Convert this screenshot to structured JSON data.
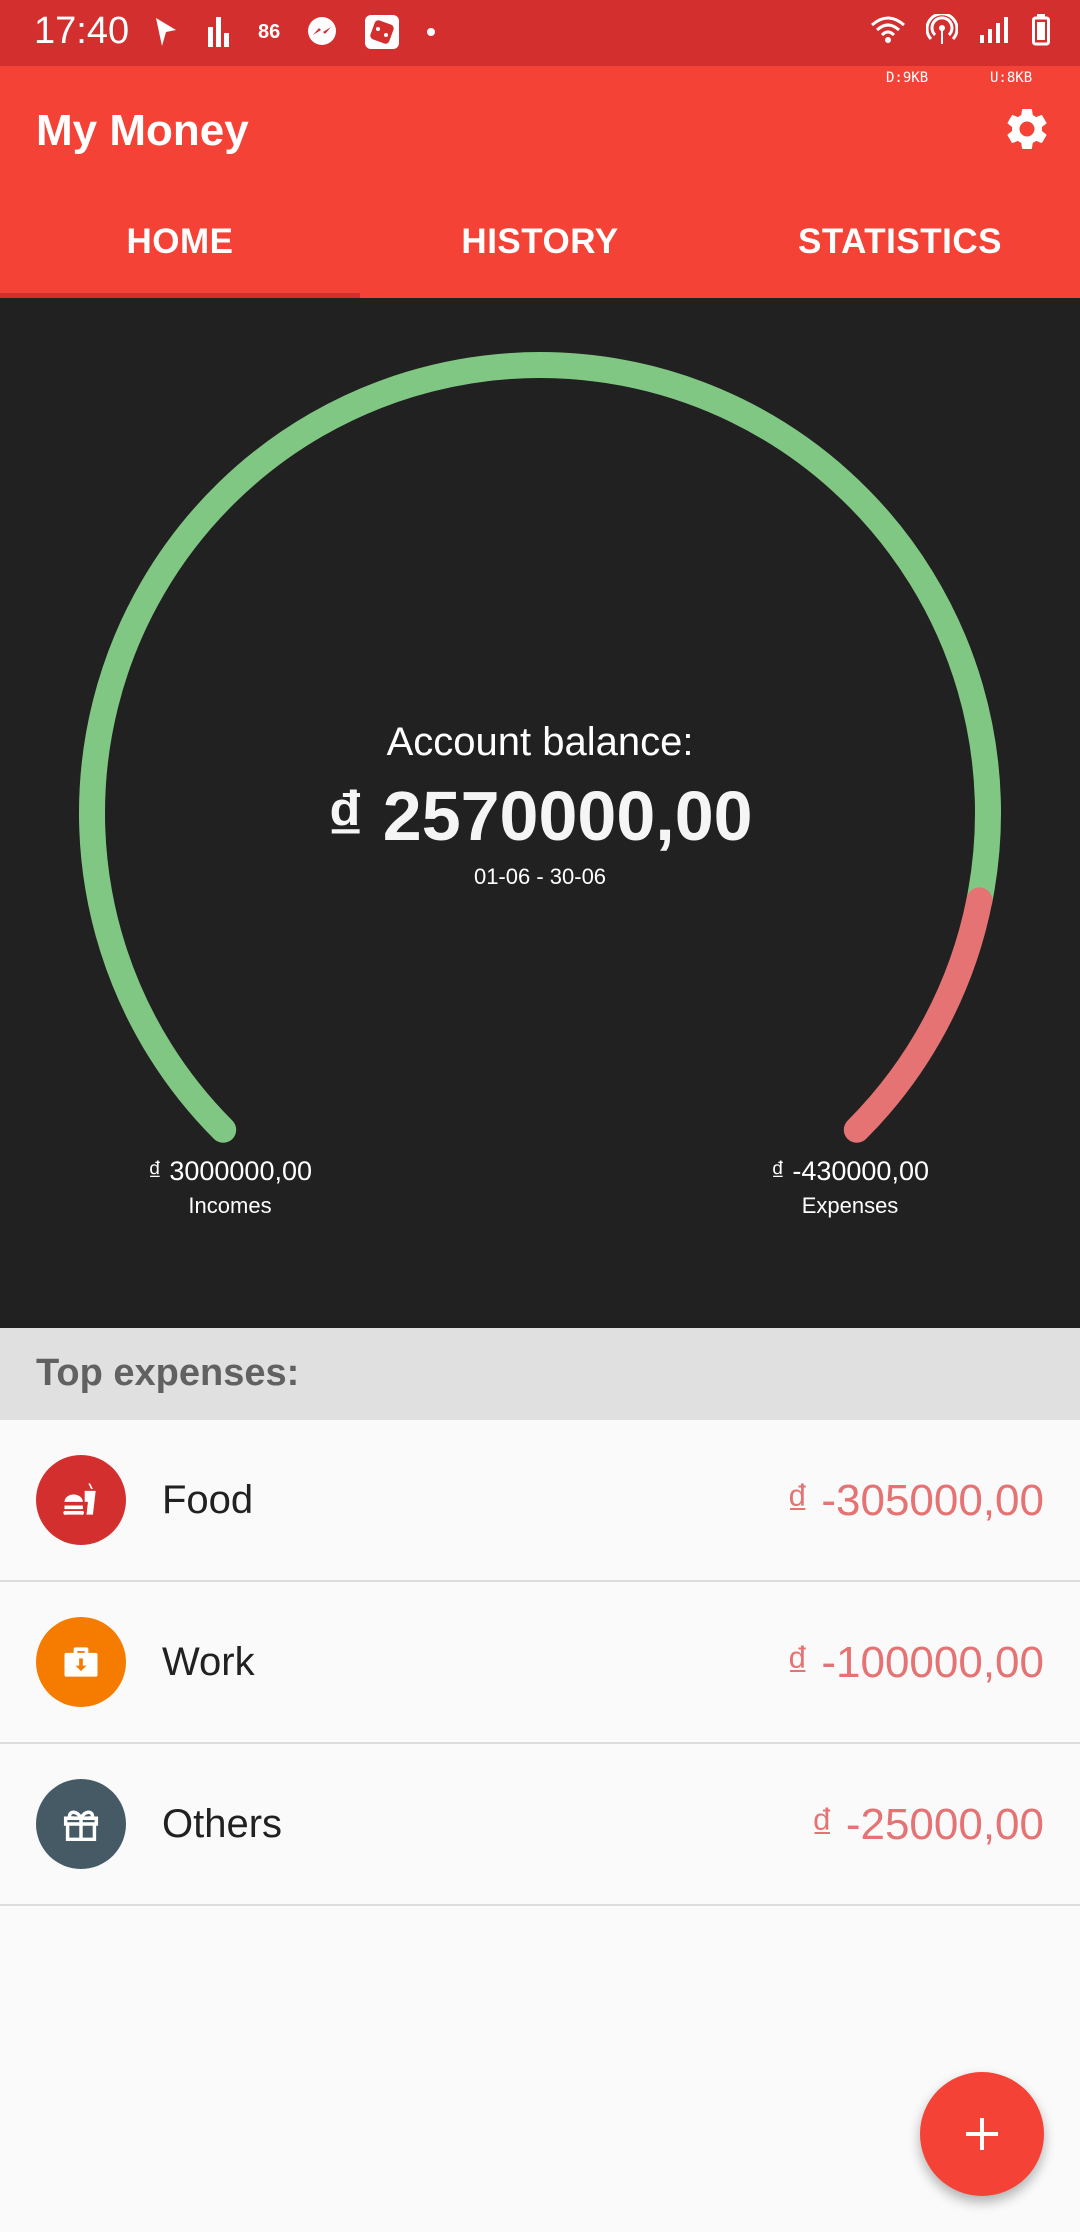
{
  "status_bar": {
    "time": "17:40",
    "notif_count": "86"
  },
  "app_bar": {
    "title": "My Money",
    "download_rate": "D:9KB",
    "upload_rate": "U:8KB",
    "tabs": [
      {
        "label": "HOME",
        "active": true
      },
      {
        "label": "HISTORY",
        "active": false
      },
      {
        "label": "STATISTICS",
        "active": false
      }
    ]
  },
  "summary": {
    "balance_label": "Account balance:",
    "balance_value": "₫ 2570000,00",
    "date_range": "01-06 - 30-06",
    "incomes_amount": "₫ 3000000,00",
    "incomes_label": "Incomes",
    "expenses_amount": "₫ -430000,00",
    "expenses_label": "Expenses",
    "gauge_income_fraction": 0.875,
    "gauge_expense_fraction": 0.125
  },
  "top_expenses": {
    "header": "Top expenses:",
    "items": [
      {
        "name": "Food",
        "amount": "₫ -305000,00",
        "color": "#d32f2f",
        "icon": "fast-food-icon"
      },
      {
        "name": "Work",
        "amount": "₫ -100000,00",
        "color": "#f57c00",
        "icon": "briefcase-icon"
      },
      {
        "name": "Others",
        "amount": "₫ -25000,00",
        "color": "#455a64",
        "icon": "gift-icon"
      }
    ]
  },
  "colors": {
    "primary": "#f44336",
    "primary_dark": "#d32f2f",
    "income": "#81c784",
    "expense": "#e57373"
  }
}
